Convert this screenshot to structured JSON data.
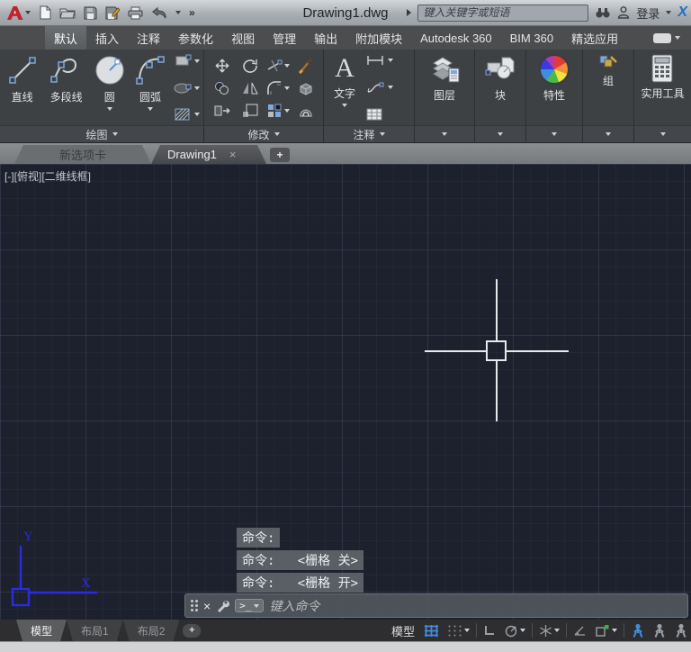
{
  "colors": {
    "accent_blue": "#3f8fdd",
    "osnap_green": "#35b24a",
    "logo_red": "#c2222a",
    "x_logo_blue": "#1d72c4",
    "ucs_blue": "#2b2be0",
    "drawing_bg": "#1d212e",
    "crosshair": "#e7e9eb"
  },
  "glyphs": {
    "close": "×",
    "plus": "+",
    "overflow": "»"
  },
  "title_bar": {
    "title": "Drawing1.dwg",
    "search_placeholder": "键入关键字或短语",
    "sign_in_label": "登录",
    "x_logo": "X",
    "qat_icons": [
      "app-menu",
      "new-file",
      "open-file",
      "save",
      "save-as",
      "plot",
      "undo",
      "toolbar-overflow"
    ]
  },
  "ribbon_tabs": [
    {
      "label": "默认",
      "active": true
    },
    {
      "label": "插入"
    },
    {
      "label": "注释"
    },
    {
      "label": "参数化"
    },
    {
      "label": "视图"
    },
    {
      "label": "管理"
    },
    {
      "label": "输出"
    },
    {
      "label": "附加模块"
    },
    {
      "label": "Autodesk 360"
    },
    {
      "label": "BIM 360"
    },
    {
      "label": "精选应用"
    }
  ],
  "panels": {
    "draw": {
      "label": "绘图",
      "line": "直线",
      "polyline": "多段线",
      "circle": "圆",
      "arc": "圆弧",
      "small_icons": [
        "rectangle",
        "ellipse",
        "hatch"
      ]
    },
    "modify": {
      "label": "修改",
      "icons": [
        "move",
        "rotate",
        "trim",
        "erase",
        "copy",
        "mirror",
        "fillet",
        "explode",
        "stretch",
        "scale",
        "array",
        "offset"
      ]
    },
    "annotate": {
      "label": "注释",
      "text": "文字",
      "icons": [
        "dimension",
        "leader",
        "table"
      ]
    },
    "layers": {
      "label": "图层"
    },
    "block": {
      "label": "块"
    },
    "properties": {
      "label": "特性"
    },
    "group": {
      "label": "组"
    },
    "utilities": {
      "label": "实用工具"
    }
  },
  "file_tabs": {
    "tabs": [
      {
        "label": "新选项卡",
        "active": false
      },
      {
        "label": "Drawing1",
        "active": true
      }
    ]
  },
  "viewport": {
    "controls": "[-][俯视][二维线框]"
  },
  "ucs": {
    "x_label": "X",
    "y_label": "Y"
  },
  "command": {
    "history": [
      "命令:",
      "命令:   <栅格 关>",
      "命令:   <栅格 开>"
    ],
    "placeholder": "键入命令"
  },
  "layout_bar": {
    "tabs": [
      {
        "label": "模型",
        "active": true
      },
      {
        "label": "布局1",
        "active": false
      },
      {
        "label": "布局2",
        "active": false
      }
    ],
    "model_label": "模型",
    "status_icons": [
      "grid",
      "snap",
      "ortho",
      "polar-tracking",
      "isodraft",
      "object-snap-tracking",
      "object-snap",
      "annotation-visibility",
      "annotation-autoscale",
      "annotation-scale"
    ]
  }
}
